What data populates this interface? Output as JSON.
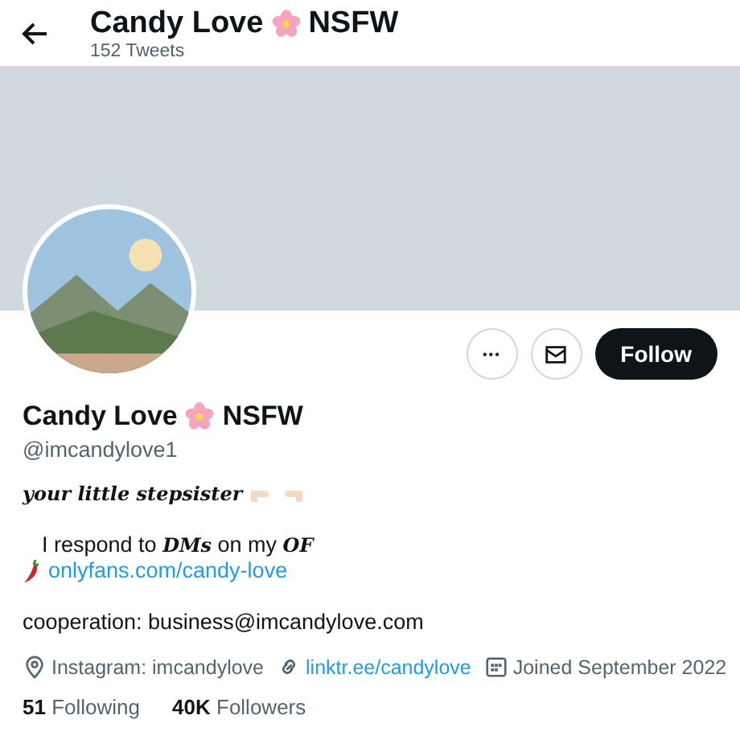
{
  "header": {
    "name": "Candy Love",
    "name_suffix": "NSFW",
    "tweet_count": "152 Tweets"
  },
  "profile": {
    "name": "Candy Love",
    "name_suffix": "NSFW",
    "handle": "@imcandylove1"
  },
  "actions": {
    "more": "•••",
    "follow": "Follow"
  },
  "bio": [
    {
      "kind": "tagline",
      "text": "your little stepsister"
    },
    {
      "kind": "gap"
    },
    {
      "kind": "text",
      "text": "I respond to **DMs** on my **OF**"
    },
    {
      "kind": "link",
      "text": "onlyfans.com/candy-love"
    },
    {
      "kind": "gap"
    },
    {
      "kind": "plain",
      "text": "cooperation: business@imcandylove.com"
    }
  ],
  "meta": [
    {
      "kind": "location",
      "text": "Instagram: imcandylove"
    },
    {
      "kind": "link",
      "text": "linktr.ee/candylove"
    },
    {
      "kind": "joined",
      "text": "Joined September 2022"
    }
  ],
  "stats": [
    {
      "count": "51",
      "label": "Following"
    },
    {
      "count": "40K",
      "label": "Followers"
    }
  ]
}
